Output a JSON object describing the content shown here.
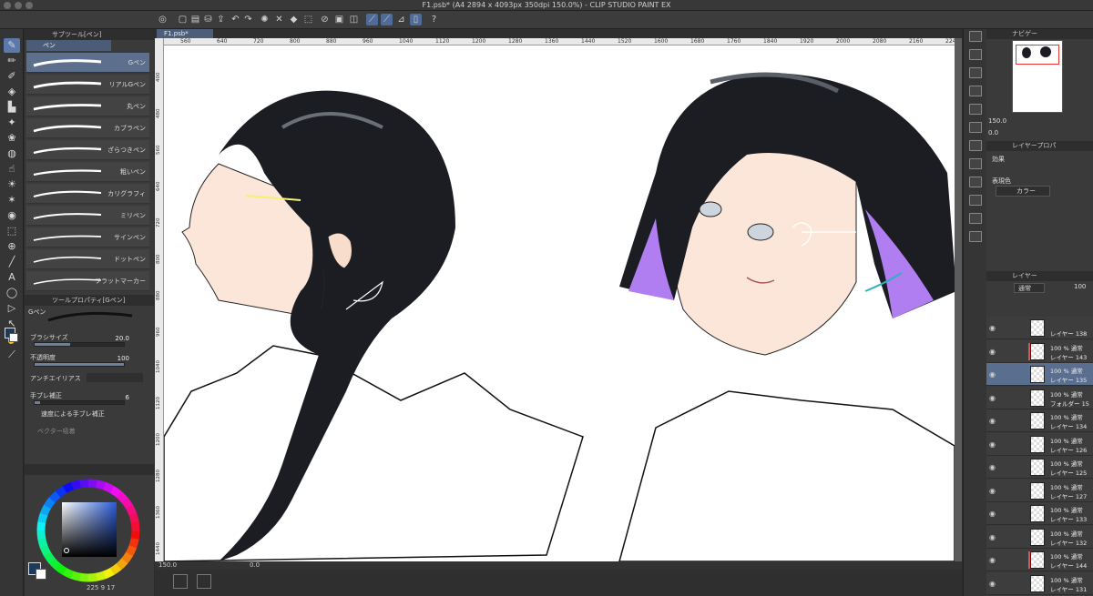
{
  "window": {
    "title": "F1.psb* (A4 2894 x 4093px 350dpi 150.0%)  - CLIP STUDIO PAINT EX"
  },
  "doc_tab": "F1.psb*",
  "subtool": {
    "header": "サブツール[ペン]",
    "group": "ペン",
    "brushes": [
      "Gペン",
      "リアルGペン",
      "丸ペン",
      "カブラペン",
      "ざらつきペン",
      "粗いペン",
      "カリグラフィ",
      "ミリペン",
      "サインペン",
      "ドットペン",
      "フラットマーカー"
    ]
  },
  "toolprop": {
    "header": "ツールプロパティ[Gペン]",
    "name": "Gペン",
    "size_label": "ブラシサイズ",
    "size_value": "20.0",
    "opacity_label": "不透明度",
    "opacity_value": "100",
    "opacity_fill": 1.0,
    "size_fill": 0.4,
    "aa_label": "アンチエイリアス",
    "stab_label": "手ブレ補正",
    "stab_value": "6",
    "speed_label": "速度による手ブレ補正",
    "vector_label": "ベクター吸着"
  },
  "color": {
    "hue_primary": "#2a5bd7",
    "main": "#1d3a5a",
    "sub": "#ffffff",
    "footer": "225  9  17"
  },
  "ruler_h": [
    "560",
    "640",
    "720",
    "800",
    "880",
    "960",
    "1040",
    "1120",
    "1200",
    "1280",
    "1360",
    "1440",
    "1520",
    "1600",
    "1680",
    "1760",
    "1840",
    "1920",
    "2000",
    "2080",
    "2160",
    "2240"
  ],
  "ruler_v": [
    "400",
    "480",
    "560",
    "640",
    "720",
    "800",
    "880",
    "960",
    "1040",
    "1120",
    "1200",
    "1280",
    "1360",
    "1440"
  ],
  "status": {
    "zoom": "150.0",
    "rotation": "0.0"
  },
  "navigator": {
    "header": "ナビゲー",
    "zoom": "150.0",
    "rotate": "0.0"
  },
  "layerprop": {
    "header": "レイヤープロパ",
    "effect_label": "効果",
    "display_label": "表現色",
    "display_value": "カラー"
  },
  "layers_panel": {
    "header": "レイヤー",
    "blend": "通常",
    "opacity": "100",
    "layers": [
      {
        "pct": "",
        "name": "レイヤー 138",
        "sel": false,
        "mark": false
      },
      {
        "pct": "100 %  通常",
        "name": "レイヤー 143",
        "sel": false,
        "mark": true
      },
      {
        "pct": "100 %  通常",
        "name": "レイヤー 135",
        "sel": true,
        "mark": false
      },
      {
        "pct": "100 %  通常",
        "name": "フォルダー 15",
        "sel": false,
        "mark": false
      },
      {
        "pct": "100 %  通常",
        "name": "レイヤー 134",
        "sel": false,
        "mark": false
      },
      {
        "pct": "100 %  通常",
        "name": "レイヤー 126",
        "sel": false,
        "mark": false
      },
      {
        "pct": "100 %  通常",
        "name": "レイヤー 125",
        "sel": false,
        "mark": false
      },
      {
        "pct": "100 %  通常",
        "name": "レイヤー 127",
        "sel": false,
        "mark": false
      },
      {
        "pct": "100 %  通常",
        "name": "レイヤー 133",
        "sel": false,
        "mark": false
      },
      {
        "pct": "100 %  通常",
        "name": "レイヤー 132",
        "sel": false,
        "mark": false
      },
      {
        "pct": "100 %  通常",
        "name": "レイヤー 144",
        "sel": false,
        "mark": true
      },
      {
        "pct": "100 %  通常",
        "name": "レイヤー 131",
        "sel": false,
        "mark": false
      },
      {
        "pct": "100 %  通常",
        "name": "",
        "sel": false,
        "mark": false
      }
    ]
  }
}
